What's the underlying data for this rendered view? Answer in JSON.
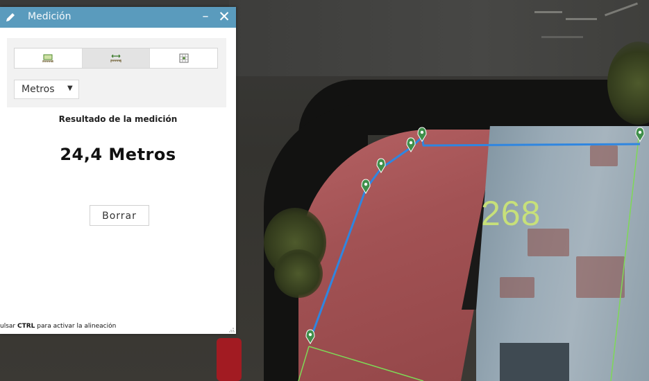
{
  "widget": {
    "title": "Medición",
    "title_icon": "pencil-icon",
    "minimize_label": "–",
    "close_label": "✕"
  },
  "tools": [
    {
      "name": "area-measure-icon",
      "active": false
    },
    {
      "name": "distance-measure-icon",
      "active": true
    },
    {
      "name": "location-measure-icon",
      "active": false
    }
  ],
  "unit_select": {
    "value": "Metros"
  },
  "result": {
    "title": "Resultado de la medición",
    "value": "24,4 Metros"
  },
  "clear_label": "Borrar",
  "hint": {
    "prefix": "ulsar ",
    "key": "CTRL",
    "suffix": " para activar la alineación"
  },
  "map": {
    "parcel_label": "268",
    "measure_line_color": "#2f86e0",
    "vertex_color": "#3f8f4a",
    "parcel_line_color": "#7ed957"
  }
}
